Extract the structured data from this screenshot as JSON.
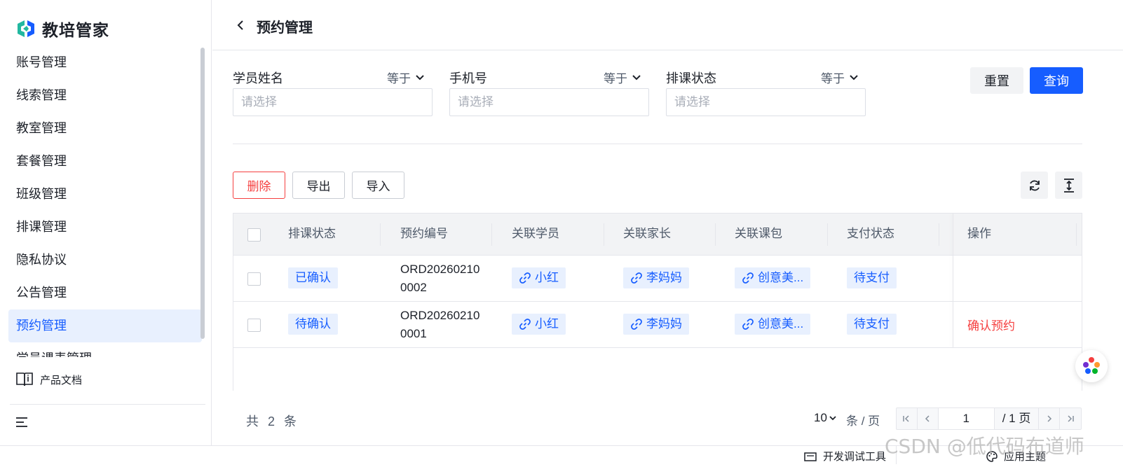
{
  "app": {
    "name": "教培管家"
  },
  "sidebar": {
    "items": [
      {
        "label": "账号管理"
      },
      {
        "label": "线索管理"
      },
      {
        "label": "教室管理"
      },
      {
        "label": "套餐管理"
      },
      {
        "label": "班级管理"
      },
      {
        "label": "排课管理"
      },
      {
        "label": "隐私协议"
      },
      {
        "label": "公告管理"
      },
      {
        "label": "预约管理",
        "active": true
      },
      {
        "label": "学员课表管理"
      }
    ],
    "doc_label": "产品文档"
  },
  "header": {
    "title": "预约管理"
  },
  "filters": [
    {
      "label": "学员姓名",
      "operator": "等于",
      "placeholder": "请选择"
    },
    {
      "label": "手机号",
      "operator": "等于",
      "placeholder": "请选择"
    },
    {
      "label": "排课状态",
      "operator": "等于",
      "placeholder": "请选择"
    }
  ],
  "actions": {
    "reset": "重置",
    "query": "查询"
  },
  "toolbar": {
    "delete": "删除",
    "export": "导出",
    "import": "导入"
  },
  "table": {
    "columns": [
      "排课状态",
      "预约编号",
      "关联学员",
      "关联家长",
      "关联课包",
      "支付状态",
      "操作"
    ],
    "rows": [
      {
        "status": "已确认",
        "order_no_1": "ORD20260210",
        "order_no_2": "0002",
        "student": "小红",
        "parent": "李妈妈",
        "package": "创意美...",
        "pay_status": "待支付",
        "op": ""
      },
      {
        "status": "待确认",
        "order_no_1": "ORD20260210",
        "order_no_2": "0001",
        "student": "小红",
        "parent": "李妈妈",
        "package": "创意美...",
        "pay_status": "待支付",
        "op": "确认预约"
      }
    ]
  },
  "pagination": {
    "total": "共 2 条",
    "page_size": "10",
    "unit": "条 / 页",
    "current": "1",
    "pages": "/ 1 页"
  },
  "bottombar": {
    "dev_tool": "开发调试工具",
    "theme": "应用主题"
  },
  "watermark": "CSDN @低代码布道师",
  "colors": {
    "primary": "#165dff",
    "danger": "#f53f3f",
    "active_bg": "#e8f0fe"
  }
}
